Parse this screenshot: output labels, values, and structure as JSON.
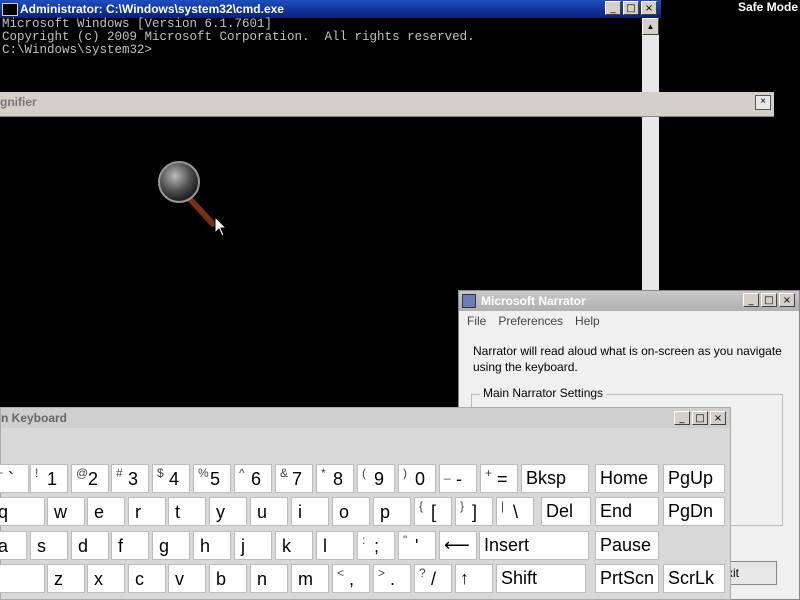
{
  "safe_mode": "Safe Mode",
  "cmd": {
    "title": "Administrator: C:\\Windows\\system32\\cmd.exe",
    "lines": [
      "Microsoft Windows [Version 6.1.7601]",
      "Copyright (c) 2009 Microsoft Corporation.  All rights reserved.",
      "",
      "C:\\Windows\\system32>"
    ],
    "buttons": [
      "_",
      "□",
      "×"
    ]
  },
  "magnifier": {
    "title": "gnifier",
    "close": "×"
  },
  "narrator": {
    "title": "Microsoft Narrator",
    "menu": [
      "File",
      "Preferences",
      "Help"
    ],
    "description": "Narrator will read aloud what is on-screen as you navigate using the keyboard.",
    "group_label": "Main Narrator Settings",
    "exit_label": "xit",
    "buttons": [
      "_",
      "□",
      "×"
    ]
  },
  "keyboard": {
    "title": "n Keyboard",
    "buttons": [
      "_",
      "□",
      "×"
    ],
    "rows": [
      [
        {
          "shift": "~",
          "main": "`"
        },
        {
          "shift": "!",
          "main": "1"
        },
        {
          "shift": "@",
          "main": "2"
        },
        {
          "shift": "#",
          "main": "3"
        },
        {
          "shift": "$",
          "main": "4"
        },
        {
          "shift": "%",
          "main": "5"
        },
        {
          "shift": "^",
          "main": "6"
        },
        {
          "shift": "&",
          "main": "7"
        },
        {
          "shift": "*",
          "main": "8"
        },
        {
          "shift": "(",
          "main": "9"
        },
        {
          "shift": ")",
          "main": "0"
        },
        {
          "shift": "_",
          "main": "-"
        },
        {
          "shift": "+",
          "main": "="
        },
        {
          "label": "Bksp"
        },
        {
          "label": "Home"
        },
        {
          "label": "PgUp"
        }
      ],
      [
        {
          "main": "q"
        },
        {
          "main": "w"
        },
        {
          "main": "e"
        },
        {
          "main": "r"
        },
        {
          "main": "t"
        },
        {
          "main": "y"
        },
        {
          "main": "u"
        },
        {
          "main": "i"
        },
        {
          "main": "o"
        },
        {
          "main": "p"
        },
        {
          "shift": "{",
          "main": "["
        },
        {
          "shift": "}",
          "main": "]"
        },
        {
          "shift": "|",
          "main": "\\"
        },
        {
          "label": "Del"
        },
        {
          "label": "End"
        },
        {
          "label": "PgDn"
        }
      ],
      [
        {
          "main": "a"
        },
        {
          "main": "s"
        },
        {
          "main": "d"
        },
        {
          "main": "f"
        },
        {
          "main": "g"
        },
        {
          "main": "h"
        },
        {
          "main": "j"
        },
        {
          "main": "k"
        },
        {
          "main": "l"
        },
        {
          "shift": ":",
          "main": ";"
        },
        {
          "shift": "\"",
          "main": "'"
        },
        {
          "label": "⟵"
        },
        {
          "label": "Insert"
        },
        {
          "label": "Pause"
        }
      ],
      [
        {
          "main": ""
        },
        {
          "main": "z"
        },
        {
          "main": "x"
        },
        {
          "main": "c"
        },
        {
          "main": "v"
        },
        {
          "main": "b"
        },
        {
          "main": "n"
        },
        {
          "main": "m"
        },
        {
          "shift": "<",
          "main": ","
        },
        {
          "shift": ">",
          "main": "."
        },
        {
          "shift": "?",
          "main": "/"
        },
        {
          "label": "↑"
        },
        {
          "label": "Shift"
        },
        {
          "label": "PrtScn"
        },
        {
          "label": "ScrLk"
        }
      ]
    ]
  }
}
